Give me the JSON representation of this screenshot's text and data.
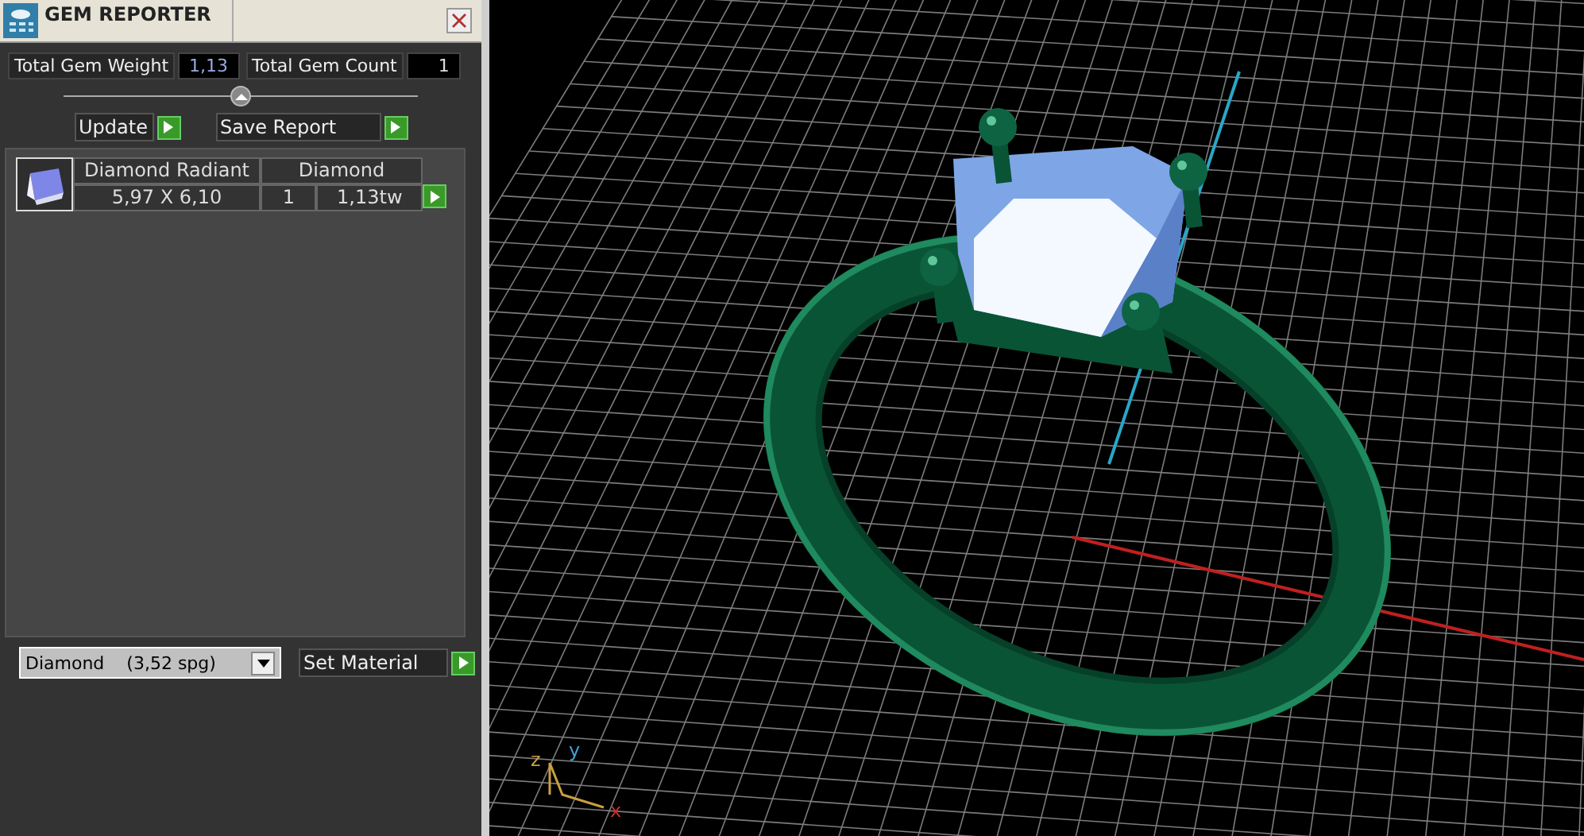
{
  "panel": {
    "title": "GEM REPORTER",
    "stats": [
      {
        "label": "Total Gem Weight",
        "value": "1,13"
      },
      {
        "label": "Total Gem Count",
        "value": "1"
      }
    ],
    "actions": [
      {
        "label": "Update",
        "kind": "short"
      },
      {
        "label": "Save Report",
        "kind": "wide"
      }
    ],
    "gems": [
      {
        "name": "Diamond Radiant",
        "material": "Diamond",
        "size": "5,97 X 6,10",
        "count": "1",
        "weight": "1,13tw"
      }
    ],
    "material_select": {
      "material": "Diamond",
      "density": "(3,52 spg)"
    },
    "set_button": "Set Material"
  },
  "viewport": {
    "axis_labels": [
      {
        "kind": "z",
        "text": "z"
      },
      {
        "kind": "y",
        "text": "y"
      },
      {
        "kind": "x",
        "text": "x"
      }
    ]
  }
}
